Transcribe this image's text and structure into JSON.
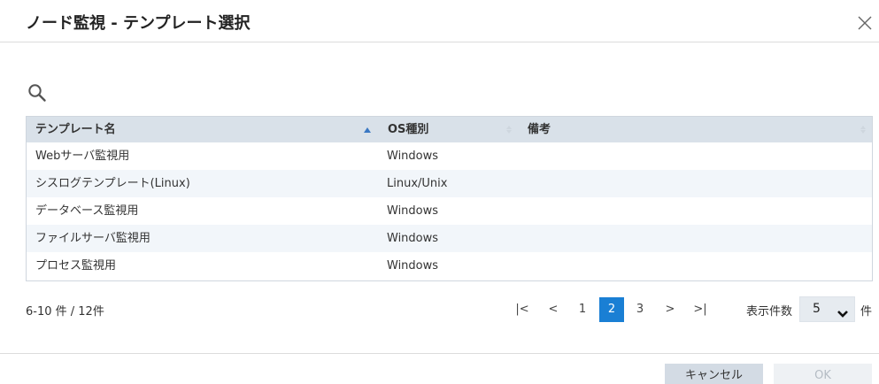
{
  "dialog": {
    "title": "ノード監視 - テンプレート選択"
  },
  "table": {
    "columns": [
      {
        "label": "テンプレート名",
        "sort": "ascending"
      },
      {
        "label": "OS種別",
        "sort": "none"
      },
      {
        "label": "備考",
        "sort": "none"
      }
    ],
    "rows": [
      {
        "name": "Webサーバ監視用",
        "os": "Windows",
        "note": ""
      },
      {
        "name": "シスログテンプレート(Linux)",
        "os": "Linux/Unix",
        "note": ""
      },
      {
        "name": "データベース監視用",
        "os": "Windows",
        "note": ""
      },
      {
        "name": "ファイルサーバ監視用",
        "os": "Windows",
        "note": ""
      },
      {
        "name": "プロセス監視用",
        "os": "Windows",
        "note": ""
      }
    ]
  },
  "pagination": {
    "range_text": "6-10 件 / 12件",
    "first": "|<",
    "prev": "<",
    "pages": [
      "1",
      "2",
      "3"
    ],
    "current_page": "2",
    "next": ">",
    "last": ">|",
    "per_page_label": "表示件数",
    "per_page_value": "5",
    "per_page_unit": "件"
  },
  "buttons": {
    "cancel": "キャンセル",
    "ok": "OK"
  },
  "colors": {
    "accent": "#1a7fd4",
    "header_bg": "#d9e1e9",
    "row_alt_bg": "#f2f6fa",
    "sort_indicator": "#3a78c3"
  },
  "icons": {
    "close": "close-icon",
    "search": "search-icon",
    "per_page_dropdown": "chevron-down-icon"
  }
}
